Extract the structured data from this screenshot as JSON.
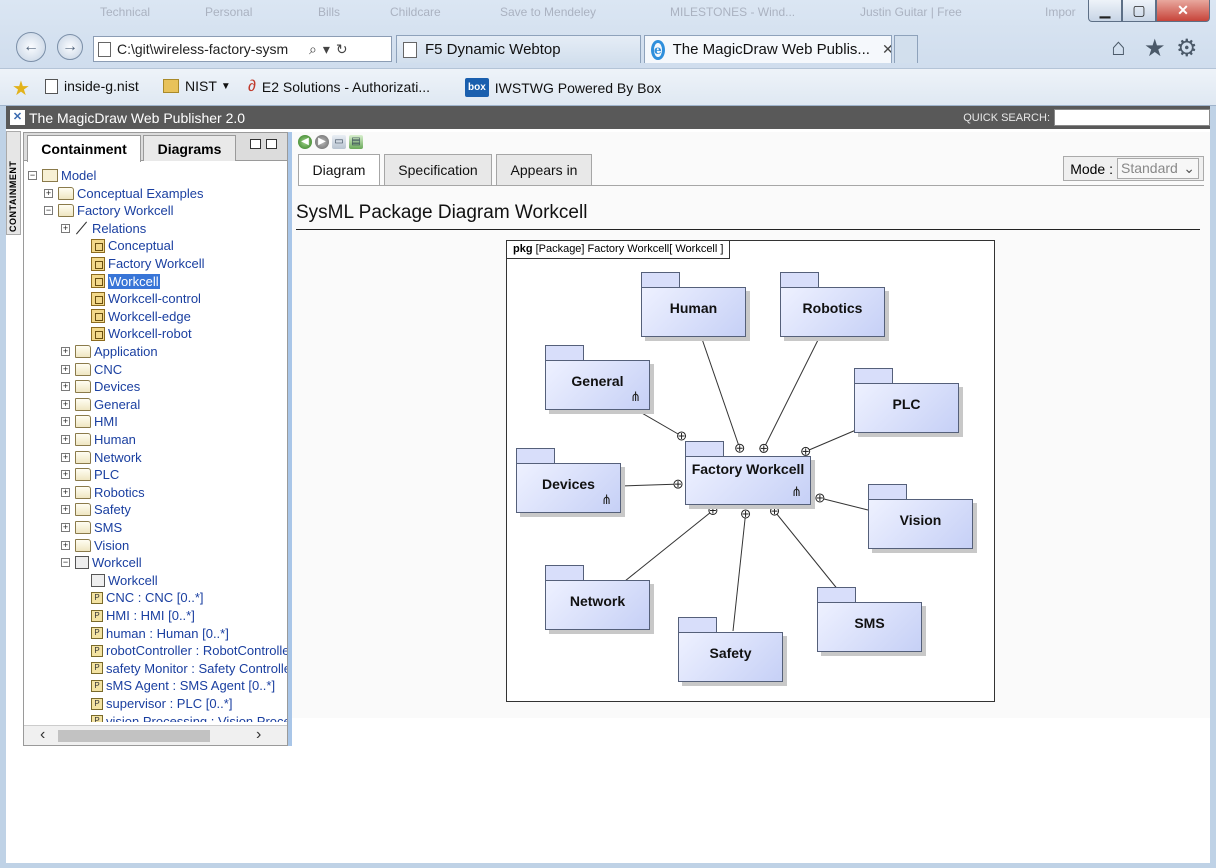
{
  "browser": {
    "ghost_items": [
      "Technical",
      "Personal",
      "Bills",
      "Childcare",
      "Save to Mendeley",
      "MILESTONES - Wind...",
      "Justin Guitar | Free",
      "Impor"
    ],
    "address": "C:\\git\\wireless-factory-sysm",
    "tabs": [
      {
        "label": "F5 Dynamic Webtop"
      },
      {
        "label": "The MagicDraw Web Publis..."
      }
    ],
    "favorites": [
      {
        "label": "inside-g.nist"
      },
      {
        "label": "NIST"
      },
      {
        "label": "E2 Solutions - Authorizati..."
      },
      {
        "label": "IWSTWG  Powered By Box"
      }
    ]
  },
  "app": {
    "title": "The MagicDraw Web Publisher 2.0",
    "quick_search_label": "QUICK SEARCH:",
    "side_tab": "CONTAINMENT"
  },
  "left_panel": {
    "tabs": [
      "Containment",
      "Diagrams"
    ],
    "tree": [
      {
        "label": "Model",
        "level": 0,
        "toggle": "-",
        "icon": "pkgfolder"
      },
      {
        "label": "Conceptual Examples",
        "level": 1,
        "toggle": "+",
        "icon": "folder"
      },
      {
        "label": "Factory Workcell",
        "level": 1,
        "toggle": "-",
        "icon": "folder"
      },
      {
        "label": "Relations",
        "level": 2,
        "toggle": "+",
        "icon": "rel"
      },
      {
        "label": "Conceptual",
        "level": 3,
        "toggle": "",
        "icon": "diag"
      },
      {
        "label": "Factory Workcell",
        "level": 3,
        "toggle": "",
        "icon": "diag"
      },
      {
        "label": "Workcell",
        "level": 3,
        "toggle": "",
        "icon": "diag",
        "selected": true
      },
      {
        "label": "Workcell-control",
        "level": 3,
        "toggle": "",
        "icon": "diag"
      },
      {
        "label": "Workcell-edge",
        "level": 3,
        "toggle": "",
        "icon": "diag"
      },
      {
        "label": "Workcell-robot",
        "level": 3,
        "toggle": "",
        "icon": "diag"
      },
      {
        "label": "Application",
        "level": 2,
        "toggle": "+",
        "icon": "folder"
      },
      {
        "label": "CNC",
        "level": 2,
        "toggle": "+",
        "icon": "folder"
      },
      {
        "label": "Devices",
        "level": 2,
        "toggle": "+",
        "icon": "folder"
      },
      {
        "label": "General",
        "level": 2,
        "toggle": "+",
        "icon": "folder"
      },
      {
        "label": "HMI",
        "level": 2,
        "toggle": "+",
        "icon": "folder"
      },
      {
        "label": "Human",
        "level": 2,
        "toggle": "+",
        "icon": "folder"
      },
      {
        "label": "Network",
        "level": 2,
        "toggle": "+",
        "icon": "folder"
      },
      {
        "label": "PLC",
        "level": 2,
        "toggle": "+",
        "icon": "folder"
      },
      {
        "label": "Robotics",
        "level": 2,
        "toggle": "+",
        "icon": "folder"
      },
      {
        "label": "Safety",
        "level": 2,
        "toggle": "+",
        "icon": "folder"
      },
      {
        "label": "SMS",
        "level": 2,
        "toggle": "+",
        "icon": "folder"
      },
      {
        "label": "Vision",
        "level": 2,
        "toggle": "+",
        "icon": "folder"
      },
      {
        "label": "Workcell",
        "level": 2,
        "toggle": "-",
        "icon": "blk"
      },
      {
        "label": "Workcell",
        "level": 3,
        "toggle": "",
        "icon": "blk"
      },
      {
        "label": "CNC : CNC [0..*]",
        "level": 3,
        "toggle": "",
        "icon": "prop"
      },
      {
        "label": "HMI : HMI [0..*]",
        "level": 3,
        "toggle": "",
        "icon": "prop"
      },
      {
        "label": "human : Human [0..*]",
        "level": 3,
        "toggle": "",
        "icon": "prop"
      },
      {
        "label": "robotController : RobotController",
        "level": 3,
        "toggle": "",
        "icon": "prop"
      },
      {
        "label": "safety Monitor : Safety Controller",
        "level": 3,
        "toggle": "",
        "icon": "prop"
      },
      {
        "label": "sMS Agent : SMS Agent [0..*]",
        "level": 3,
        "toggle": "",
        "icon": "prop"
      },
      {
        "label": "supervisor : PLC [0..*]",
        "level": 3,
        "toggle": "",
        "icon": "prop"
      },
      {
        "label": "vision Processing : Vision Processing",
        "level": 3,
        "toggle": "",
        "icon": "prop"
      }
    ]
  },
  "right_panel": {
    "tabs": [
      "Diagram",
      "Specification",
      "Appears in"
    ],
    "mode_label": "Mode :",
    "mode_value": "Standard",
    "diagram_title": "SysML Package Diagram Workcell"
  },
  "diagram": {
    "frame_keyword": "pkg",
    "frame_label": "[Package] Factory Workcell[ Workcell ]",
    "center": "Factory Workcell",
    "packages": [
      "Human",
      "Robotics",
      "General",
      "PLC",
      "Devices",
      "Vision",
      "Network",
      "SMS",
      "Safety"
    ]
  }
}
